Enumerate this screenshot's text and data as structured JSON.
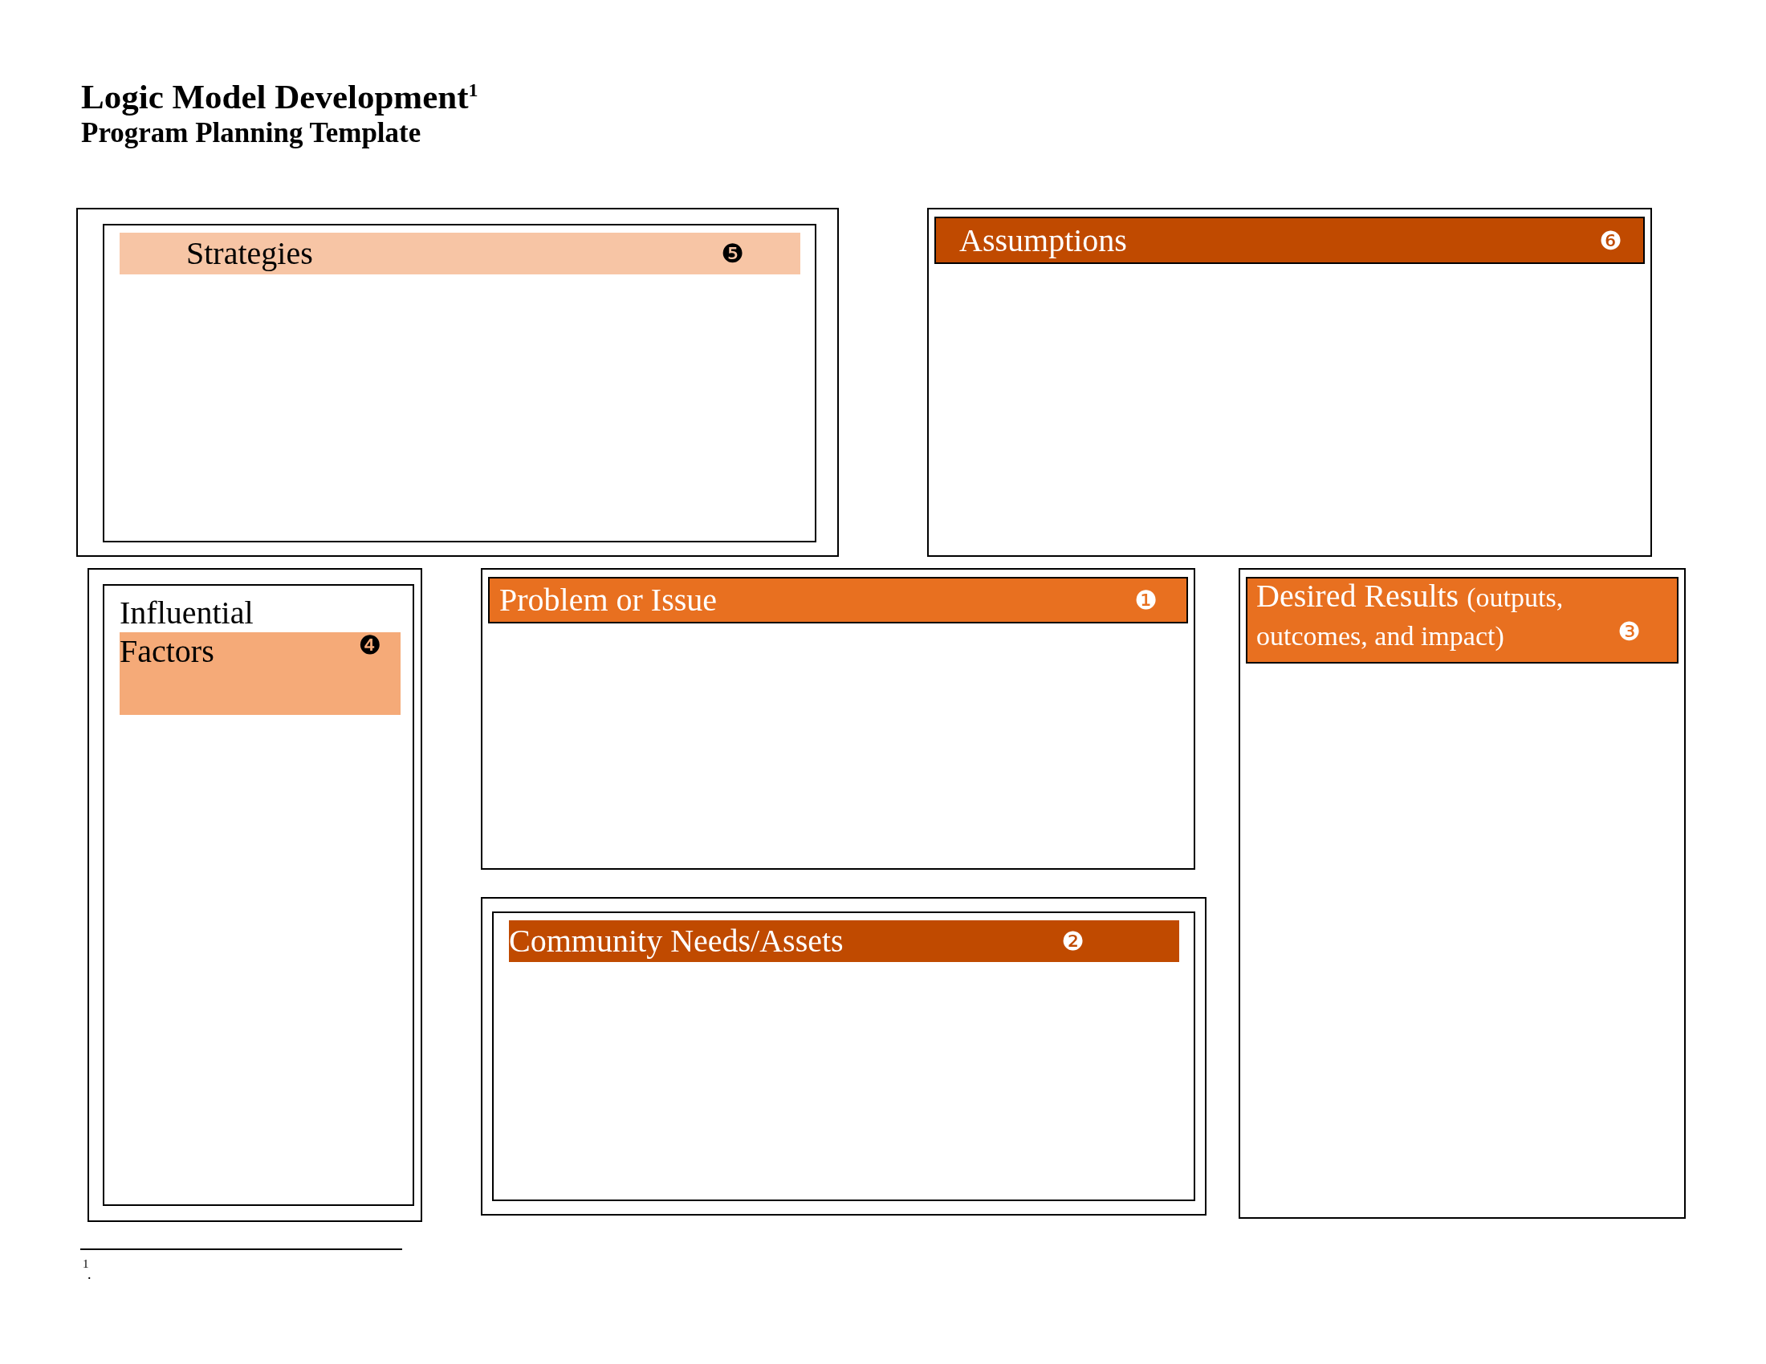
{
  "title": "Logic Model Development$^{1}$",
  "subtitle": "Program Planning Template",
  "panels": [
    {
      "framed": true,
      "header": {
        "title": "Strategies",
        "badge": "❺",
        "color": "#f7c5a5",
        "outlined": false
      }
    },
    {
      "framed": false,
      "header": {
        "title": "Assumptions",
        "badge": "❻",
        "color": "#c04a00",
        "outlined": true
      }
    },
    {
      "framed": true,
      "header": {
        "pre_title": "Influential",
        "title": "Factors",
        "badge": "❹",
        "color": "#f5aa78",
        "outlined": false
      }
    },
    {
      "framed": false,
      "header": {
        "title": "Problem or Issue",
        "badge": "❶",
        "color": "#e87020",
        "outlined": true
      }
    },
    {
      "framed": true,
      "header": {
        "title": "Community Needs/Assets",
        "badge": "❷",
        "color": "#c04a00",
        "outlined": false
      }
    },
    {
      "framed": false,
      "header": {
        "title": "Desired Results",
        "note": "(outputs, outcomes, and impact)",
        "badge": "❸",
        "color": "#e87020",
        "outlined": true
      }
    }
  ],
  "footnote": {
    "mark": "1",
    "text": "."
  }
}
